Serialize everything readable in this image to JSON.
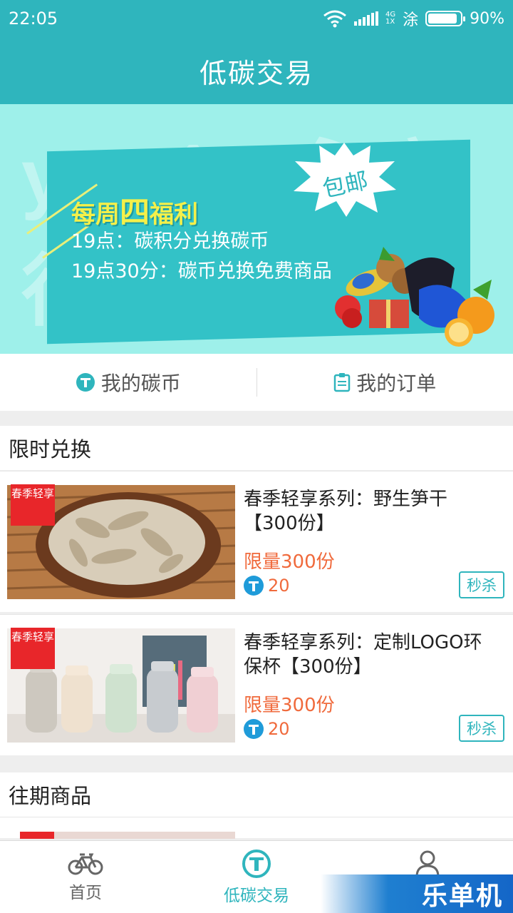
{
  "status_bar": {
    "time": "22:05",
    "network": "4G",
    "network_sub": "1X",
    "carrier_char": "涂",
    "battery": "90%",
    "battery_level": 0.9
  },
  "header": {
    "title": "低碳交易"
  },
  "banner": {
    "watermark": "youôn 永安行",
    "promo_prefix": "每周",
    "promo_big": "四",
    "promo_suffix": "福利",
    "line1": "19点：碳积分兑换碳币",
    "line2": "19点30分：碳币兑换免费商品",
    "burst_text": "包邮"
  },
  "actions": {
    "my_coins": "我的碳币",
    "my_orders": "我的订单"
  },
  "limited_section": {
    "title": "限时兑换"
  },
  "products": [
    {
      "tag": "春季轻享",
      "name": "春季轻享系列：野生笋干【300份】",
      "limit": "限量300份",
      "price": "20",
      "button": "秒杀"
    },
    {
      "tag": "春季轻享",
      "name": "春季轻享系列：定制LOGO环保杯【300份】",
      "limit": "限量300份",
      "price": "20",
      "button": "秒杀"
    }
  ],
  "past_section": {
    "title": "往期商品"
  },
  "bottom_nav": {
    "home": "首页",
    "trade": "低碳交易",
    "mine": "我的"
  },
  "corner_watermark": "乐单机",
  "colors": {
    "primary": "#2fb5bd",
    "accent_orange": "#f06a3c",
    "tag_red": "#e8262a",
    "coin_blue": "#1f9bd9"
  }
}
